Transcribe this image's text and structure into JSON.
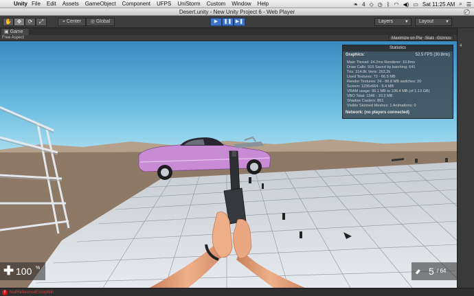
{
  "menubar": {
    "apple_glyph": "",
    "app_name": "Unity",
    "items": [
      "File",
      "Edit",
      "Assets",
      "GameObject",
      "Component",
      "UFPS",
      "UniStorm",
      "Custom",
      "Window",
      "Help"
    ],
    "tray_count": "4",
    "clock": "Sat 11:25 AM"
  },
  "window": {
    "title": "Desert.unity - New Unity Project 6 - Web Player"
  },
  "toolbar": {
    "tools": [
      "✋",
      "✥",
      "⟳",
      "⤢"
    ],
    "pivot_label": "Center",
    "space_label": "Global",
    "play_glyphs": [
      "▶",
      "❚❚",
      "▶❚"
    ],
    "layers_label": "Layers",
    "layout_label": "Layout"
  },
  "game_panel": {
    "tab_label": "Game",
    "aspect_label": "Free Aspect",
    "maximize_label": "Maximize on Play",
    "stats_label": "Stats",
    "gizmos_label": "Gizmos",
    "side_label": "4"
  },
  "stats": {
    "title": "Statistics",
    "graphics_label": "Graphics:",
    "fps": "52.5 FPS (30.8ms)",
    "lines": [
      "Main Thread: 24.2ms  Renderer: 10.8ms",
      "Draw Calls: 915  Saved by batching: 641",
      "Tris: 314.8k  Verts: 263.2k",
      "Used Textures: 72 - 66.5 MB",
      "Render Textures: 24 - 86.8 MB  switches: 20",
      "Screen: 1236x664 - 9.4 MB",
      "VRAM usage: 96.1 MB to 106.4 MB (of 1.13 GB)",
      "VBO Total: 1346 - 10.2 MB",
      "Shadow Casters: 861",
      "Visible Skinned Meshes: 1     Animations: 0"
    ],
    "network": "Network: (no players connected)"
  },
  "hud": {
    "health_value": "100",
    "health_unit": "%",
    "ammo_clip": "5",
    "ammo_reserve": "/ 64"
  },
  "console": {
    "error_text": "NullReferenceException"
  },
  "colors": {
    "sky_top": "#3d8fc4",
    "sky_bottom": "#8fd2ea",
    "desert": "#8f7b68",
    "floor": "#d9dde2",
    "car": "#c98ad6",
    "skin": "#e8a27c",
    "play_accent": "#3f74c4",
    "error": "#d01818"
  }
}
